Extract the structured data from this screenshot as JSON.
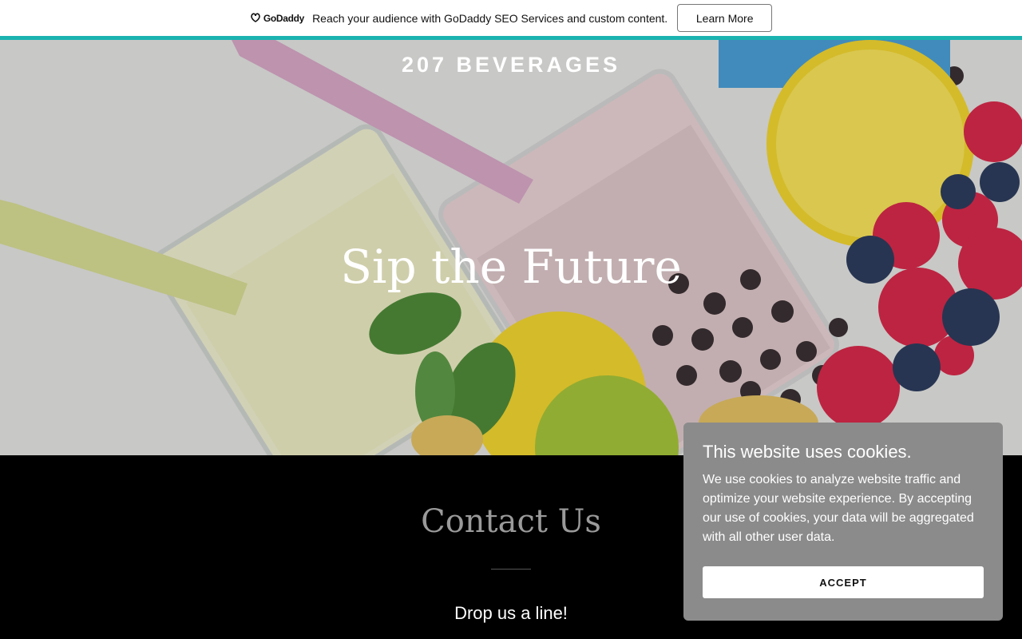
{
  "promo": {
    "logo_text": "GoDaddy",
    "message": "Reach your audience with GoDaddy SEO Services and custom content.",
    "button_label": "Learn More",
    "accent_color": "#1bb3b0"
  },
  "hero": {
    "site_title": "207 BEVERAGES",
    "tagline": "Sip the Future"
  },
  "contact": {
    "title": "Contact Us",
    "subtitle": "Drop us a line!"
  },
  "cookie_banner": {
    "title": "This website uses cookies.",
    "body": "We use cookies to analyze website traffic and optimize your website experience. By accepting our use of cookies, your data will be aggregated with all other user data.",
    "accept_label": "ACCEPT"
  }
}
